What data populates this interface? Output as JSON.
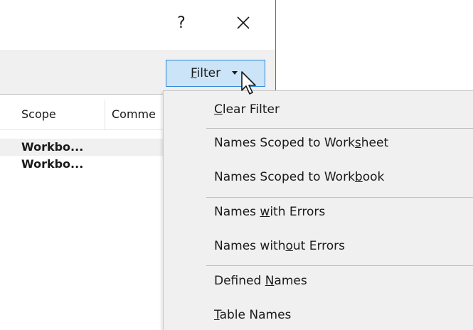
{
  "dialog": {
    "help_label": "?",
    "close_icon": "close-icon",
    "filter_button": {
      "label_pre": "",
      "label_u": "F",
      "label_post": "ilter",
      "arrow_icon": "caret-down-icon"
    }
  },
  "table": {
    "columns": [
      "Scope",
      "Comme"
    ],
    "rows": [
      {
        "scope": "Workbo...",
        "selected": true
      },
      {
        "scope": "Workbo...",
        "selected": false
      }
    ]
  },
  "filter_menu": {
    "items": [
      {
        "pre": "",
        "u": "C",
        "post": "lear Filter"
      },
      {
        "pre": "Names Scoped to Work",
        "u": "s",
        "post": "heet"
      },
      {
        "pre": "Names Scoped to Work",
        "u": "b",
        "post": "ook"
      },
      {
        "pre": "Names ",
        "u": "w",
        "post": "ith Errors"
      },
      {
        "pre": "Names with",
        "u": "o",
        "post": "ut Errors"
      },
      {
        "pre": "Defined ",
        "u": "N",
        "post": "ames"
      },
      {
        "pre": "",
        "u": "T",
        "post": "able Names"
      }
    ]
  },
  "colors": {
    "accent_border": "#2f86d8",
    "button_fill": "#cce4f7",
    "menu_bg": "#f0f0f0",
    "selected_row": "#f0f0f0"
  },
  "cursor_icon": "mouse-pointer-icon"
}
